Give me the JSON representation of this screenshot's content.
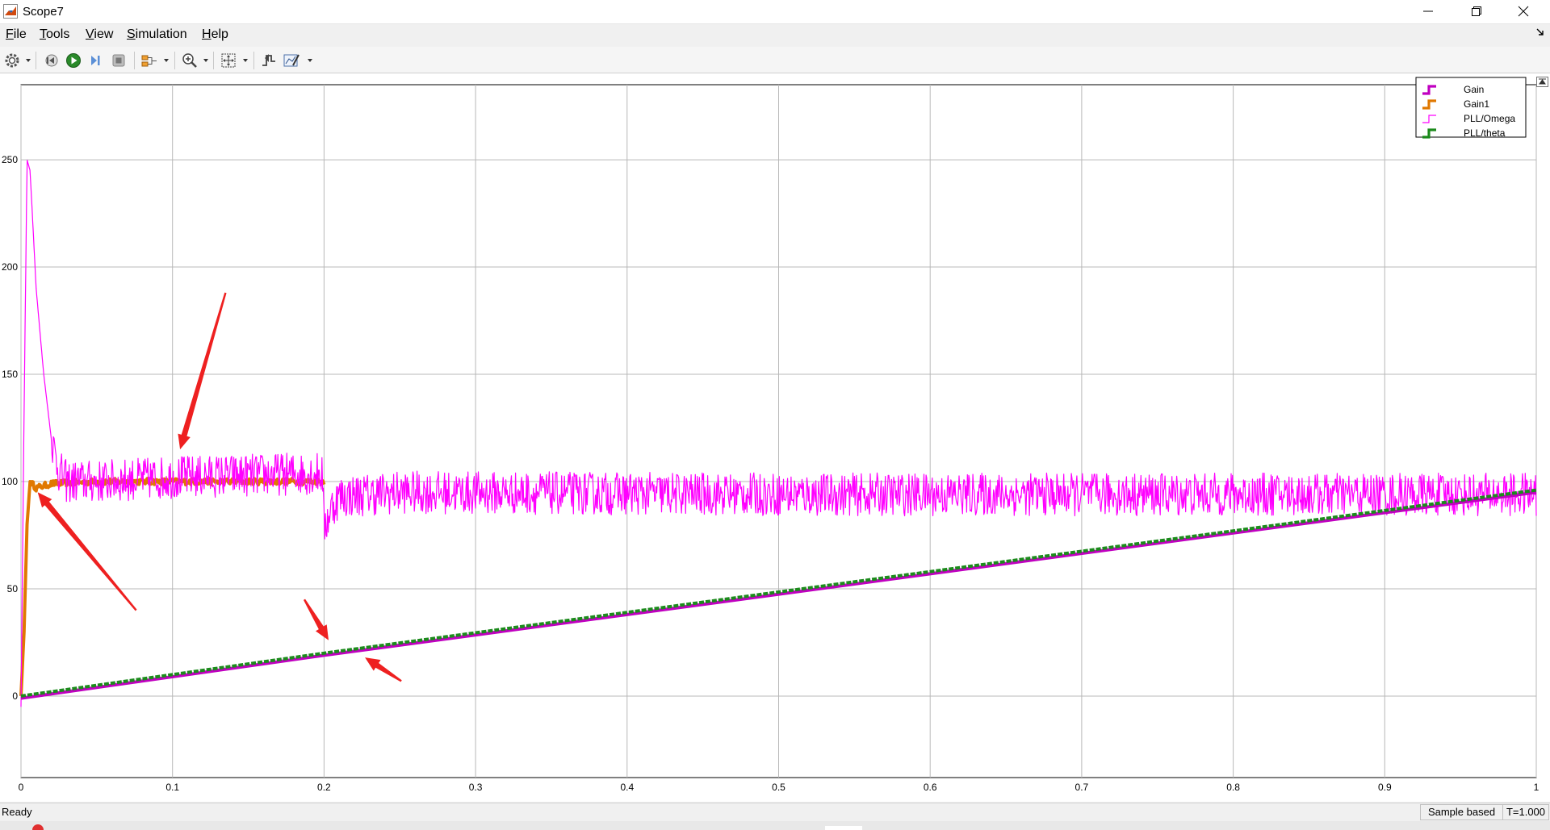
{
  "window": {
    "title": "Scope7",
    "controls": [
      "minimize-icon",
      "restore-icon",
      "close-icon"
    ]
  },
  "menu": {
    "items": [
      {
        "mnemonic": "F",
        "rest": "ile"
      },
      {
        "mnemonic": "T",
        "rest": "ools"
      },
      {
        "mnemonic": "V",
        "rest": "iew"
      },
      {
        "mnemonic": "S",
        "rest": "imulation"
      },
      {
        "mnemonic": "H",
        "rest": "elp"
      }
    ]
  },
  "toolbar": {
    "icons": [
      "configuration-gear-icon",
      "step-back-icon",
      "run-icon",
      "step-forward-icon",
      "stop-icon",
      "signal-selector-icon",
      "zoom-in-icon",
      "autoscale-icon",
      "triggers-icon",
      "measurements-cursor-icon"
    ]
  },
  "chart_data": {
    "type": "line",
    "xlim": [
      0,
      1
    ],
    "ylim": [
      -38,
      285
    ],
    "x_ticks": [
      "0",
      "0.1",
      "0.2",
      "0.3",
      "0.4",
      "0.5",
      "0.6",
      "0.7",
      "0.8",
      "0.9",
      "1"
    ],
    "y_ticks": [
      "0",
      "50",
      "100",
      "150",
      "200",
      "250"
    ],
    "x_tick_values": [
      0,
      0.1,
      0.2,
      0.3,
      0.4,
      0.5,
      0.6,
      0.7,
      0.8,
      0.9,
      1
    ],
    "y_tick_values": [
      0,
      50,
      100,
      150,
      200,
      250
    ],
    "grid": true,
    "legend_placement": "top-right",
    "series": [
      {
        "name": "Gain",
        "color": "#c000c0",
        "style": "thick",
        "x": [
          0,
          0.2,
          0.4,
          0.6,
          0.8,
          1.0
        ],
        "y": [
          -1,
          19,
          38,
          57,
          76,
          95
        ]
      },
      {
        "name": "Gain1",
        "color": "#e07800",
        "style": "thick",
        "x": [
          0,
          0.002,
          0.004,
          0.006,
          0.01,
          0.02,
          0.05,
          0.1,
          0.15,
          0.2
        ],
        "y": [
          0,
          30,
          80,
          100,
          97,
          99,
          100,
          100,
          100,
          100
        ]
      },
      {
        "name": "PLL/Omega",
        "color": "#ff00ff",
        "style": "thin",
        "x": [
          0,
          0.002,
          0.004,
          0.006,
          0.01,
          0.015,
          0.02,
          0.025,
          0.03,
          0.05,
          0.1,
          0.15,
          0.199,
          0.2,
          0.201,
          0.205,
          0.21,
          0.25,
          0.5,
          0.75,
          1.0
        ],
        "y": [
          -5,
          130,
          250,
          245,
          190,
          150,
          120,
          105,
          100,
          100,
          102,
          103,
          104,
          78,
          80,
          88,
          93,
          95,
          94,
          94,
          94
        ]
      },
      {
        "name": "PLL/theta",
        "color": "#1c8a1c",
        "style": "thick-dashed",
        "x": [
          0,
          0.2,
          0.4,
          0.6,
          0.8,
          1.0
        ],
        "y": [
          0,
          20,
          39,
          58,
          77,
          96
        ]
      }
    ],
    "annotations": [
      {
        "type": "arrow",
        "color": "#ee2020",
        "from": [
          0.135,
          188
        ],
        "to": [
          0.105,
          115
        ]
      },
      {
        "type": "arrow",
        "color": "#ee2020",
        "from": [
          0.076,
          40
        ],
        "to": [
          0.011,
          95
        ]
      },
      {
        "type": "arrow",
        "color": "#ee2020",
        "from": [
          0.187,
          45
        ],
        "to": [
          0.203,
          26
        ]
      },
      {
        "type": "arrow",
        "color": "#ee2020",
        "from": [
          0.251,
          7
        ],
        "to": [
          0.227,
          18
        ]
      }
    ]
  },
  "status": {
    "text": "Ready",
    "sample_mode": "Sample based",
    "sim_time": "T=1.000"
  }
}
